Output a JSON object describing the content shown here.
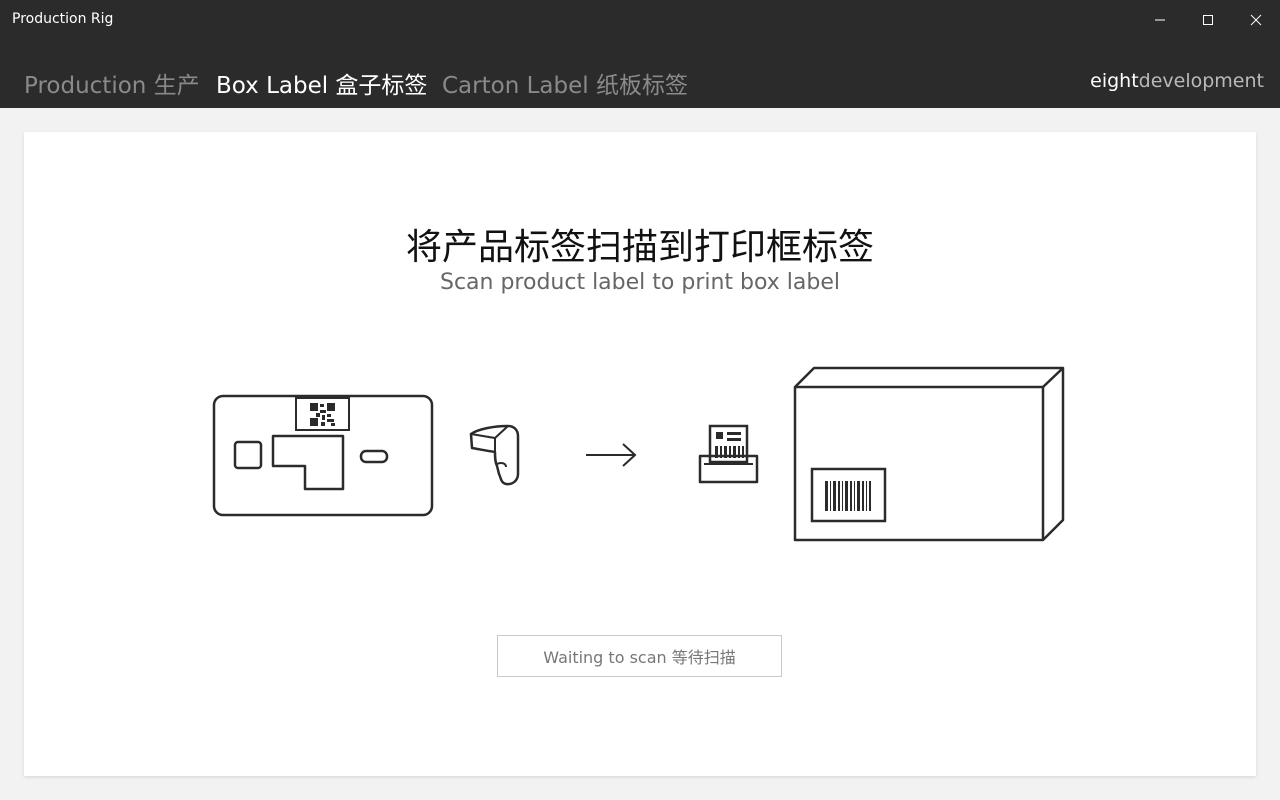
{
  "window": {
    "title": "Production Rig",
    "controls": {
      "minimize_icon": "minimize-icon",
      "maximize_icon": "maximize-icon",
      "close_icon": "close-icon"
    }
  },
  "nav": {
    "tabs": [
      {
        "label": "Production 生产",
        "active": false
      },
      {
        "label": "Box Label 盒子标签",
        "active": true
      },
      {
        "label": "Carton Label 纸板标签",
        "active": false
      }
    ],
    "brand": {
      "strong": "eight",
      "light": "development"
    }
  },
  "main": {
    "heading_cn": "将产品标签扫描到打印框标签",
    "heading_en": "Scan product label to print box label",
    "illustration": {
      "product_label_icon": "product-label-icon",
      "scanner_icon": "barcode-scanner-icon",
      "arrow_icon": "arrow-right-icon",
      "printer_icon": "label-printer-icon",
      "box_icon": "box-with-barcode-icon"
    },
    "status": "Waiting to scan 等待扫描"
  },
  "colors": {
    "titlebar": "#2b2b2b",
    "tab_active": "#ffffff",
    "tab_inactive": "#8a8a8a",
    "background": "#f2f2f2",
    "panel": "#ffffff",
    "line_art": "#2b2b2b"
  }
}
